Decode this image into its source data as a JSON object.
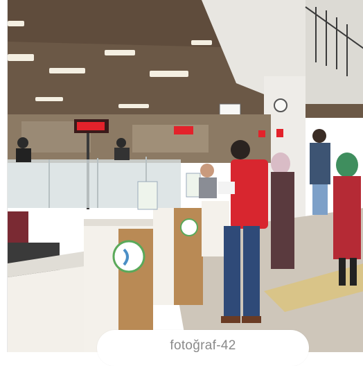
{
  "photo": {
    "subject": "service-counter-hall",
    "colors": {
      "ceiling": "#6e5a47",
      "wall": "#e9e7e2",
      "floor": "#cfc8bd",
      "counter": "#f3f0ea",
      "wood": "#b98a55",
      "red_jacket": "#d8262f",
      "jeans": "#2f4a78",
      "led_sign": "#e3222b",
      "logo_green": "#5aa95a",
      "logo_blue": "#4b8fc6"
    }
  },
  "caption": {
    "label": "fotoğraf-42"
  }
}
